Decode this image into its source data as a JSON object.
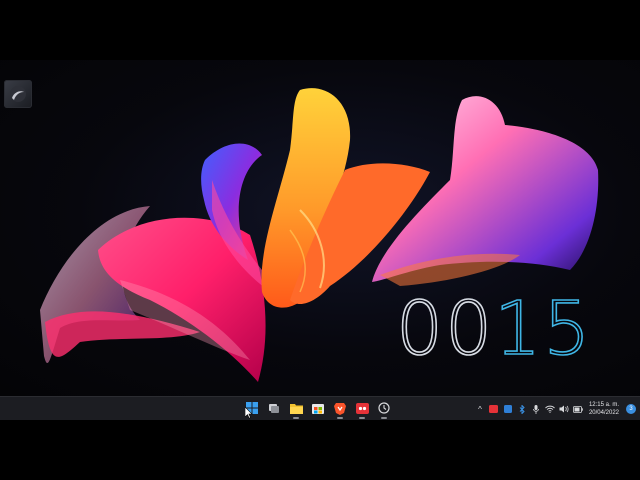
{
  "desktop": {
    "shortcut_icon": "app-shortcut-icon",
    "clock": {
      "hours": "00",
      "minutes": "15"
    }
  },
  "taskbar": {
    "apps": [
      {
        "name": "start-button",
        "icon": "windows-logo-icon"
      },
      {
        "name": "task-view-button",
        "icon": "task-view-icon"
      },
      {
        "name": "file-explorer-button",
        "icon": "folder-icon"
      },
      {
        "name": "microsoft-store-button",
        "icon": "store-icon"
      },
      {
        "name": "brave-browser-button",
        "icon": "brave-lion-icon"
      },
      {
        "name": "red-app-button",
        "icon": "red-app-icon"
      },
      {
        "name": "clock-app-button",
        "icon": "clock-icon"
      }
    ],
    "tray": {
      "chevron": "^",
      "time": "12:15 a. m.",
      "date": "20/04/2022",
      "notifications": "3"
    }
  },
  "colors": {
    "clock_hours": "#d7dce4",
    "clock_minutes": "#3fb6e6",
    "taskbar_bg": "#1c1d22",
    "accent": "#3a8fe0"
  }
}
